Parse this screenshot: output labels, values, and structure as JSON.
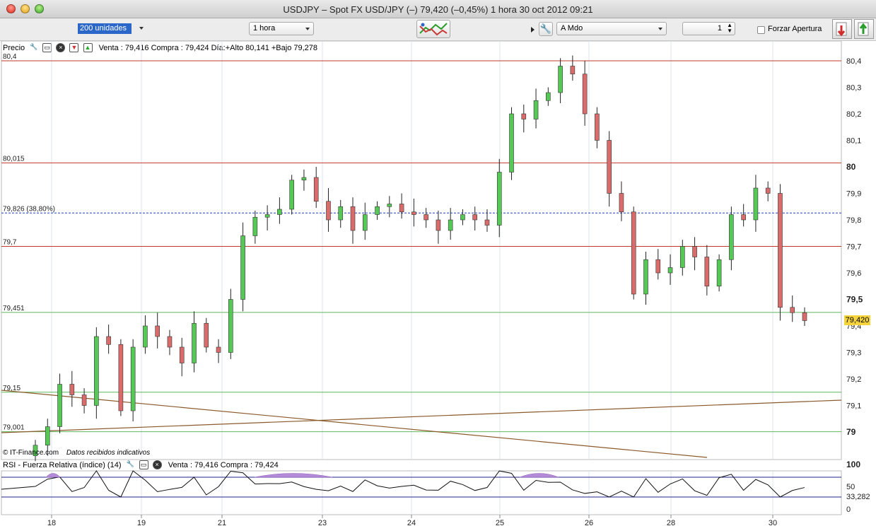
{
  "window": {
    "title": "USDJPY – Spot FX USD/JPY (–)     79,420 (–0,45%)     1 hora   30 oct 2012 09:21"
  },
  "toolbar": {
    "units_select": "200 unidades",
    "timeframe_select": "1 hora",
    "order_type_select": "A Mdo",
    "quantity_value": "1",
    "force_open_label": "Forzar Apertura"
  },
  "price_panel": {
    "label": "Precio",
    "quote": "Venta : 79,416 Compra : 79,424  Día:+Alto 80,141 +Bajo 79,278",
    "footer_brand": "© IT-Finance.com",
    "footer_note": "Datos recibidos indicativos",
    "current_price_badge": "79,420",
    "y_axis_labels": [
      "80,4",
      "80,3",
      "80,2",
      "80,1",
      "80",
      "79,9",
      "79,8",
      "79,7",
      "79,6",
      "79,5",
      "79,4",
      "79,3",
      "79,2",
      "79,1",
      "79"
    ],
    "lines": [
      {
        "label": "80,4",
        "value": 80.4,
        "color": "#c0392b"
      },
      {
        "label": "80,015",
        "value": 80.015,
        "color": "#c0392b"
      },
      {
        "label": "79,826 (38,80%)",
        "value": 79.826,
        "color": "#1f3fbf",
        "style": "dashed"
      },
      {
        "label": "79,7",
        "value": 79.7,
        "color": "#c0392b"
      },
      {
        "label": "79,451",
        "value": 79.451,
        "color": "#5fb85f"
      },
      {
        "label": "79,15",
        "value": 79.15,
        "color": "#5fb85f"
      },
      {
        "label": "79,001",
        "value": 79.001,
        "color": "#5fb85f"
      }
    ]
  },
  "rsi_panel": {
    "label": "RSI - Fuerza Relativa (índice) (14)",
    "quote": "Venta : 79,416 Compra : 79,424",
    "y_axis_labels": [
      "100",
      "50",
      "33,282",
      "0"
    ]
  },
  "x_axis_labels": [
    "18",
    "19",
    "21",
    "23",
    "24",
    "25",
    "26",
    "28",
    "30"
  ],
  "colors": {
    "up": "#55c855",
    "down": "#d96b6b",
    "resistance": "#c0392b",
    "support": "#5fb85f",
    "trend": "#8b5a2b"
  },
  "chart_data": {
    "type": "candlestick",
    "title": "",
    "ylim": [
      78.95,
      80.47
    ],
    "categories": [
      "18",
      "19",
      "21",
      "23",
      "24",
      "25",
      "26",
      "28",
      "30"
    ],
    "series": [
      {
        "name": "USDJPY",
        "close_approx": [
          78.95,
          79.02,
          79.18,
          79.14,
          79.1,
          79.36,
          79.33,
          79.08,
          79.32,
          79.4,
          79.36,
          79.32,
          79.26,
          79.41,
          79.32,
          79.3,
          79.5,
          79.74,
          79.81,
          79.82,
          79.84,
          79.95,
          79.96,
          79.87,
          79.8,
          79.85,
          79.76,
          79.82,
          79.85,
          79.86,
          79.83,
          79.82,
          79.8,
          79.76,
          79.8,
          79.82,
          79.8,
          79.78,
          79.98,
          80.2,
          80.18,
          80.25,
          80.28,
          80.38,
          80.35,
          80.2,
          80.1,
          79.9,
          79.83,
          79.52,
          79.65,
          79.6,
          79.62,
          79.7,
          79.66,
          79.55,
          79.65,
          79.82,
          79.8,
          79.92,
          79.9,
          79.47,
          79.45,
          79.42
        ]
      }
    ],
    "rsi": {
      "value": 33.282,
      "levels": [
        50,
        0,
        100
      ]
    }
  }
}
